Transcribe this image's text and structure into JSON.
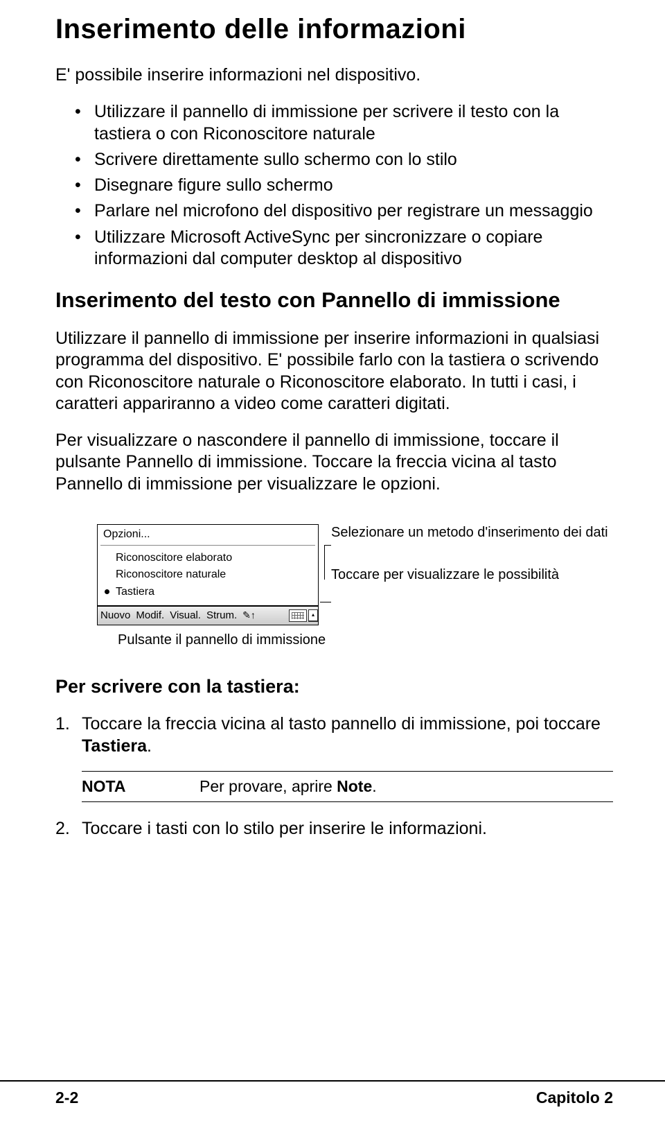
{
  "h1": "Inserimento delle informazioni",
  "intro": "E' possibile inserire informazioni nel dispositivo.",
  "bullets": [
    "Utilizzare il pannello di immissione per scrivere il testo con la tastiera o con Riconoscitore naturale",
    "Scrivere direttamente sullo schermo con lo stilo",
    "Disegnare figure sullo schermo",
    "Parlare nel microfono del dispositivo per registrare un messaggio",
    "Utilizzare Microsoft ActiveSync per sincronizzare o copiare informazioni dal computer desktop al dispositivo"
  ],
  "h2": "Inserimento del testo con Pannello di immissione",
  "para1": "Utilizzare il pannello di immissione per inserire informazioni in qualsiasi programma del dispositivo. E' possibile farlo con la tastiera o scrivendo con Riconoscitore naturale o Riconoscitore elaborato. In tutti i casi, i caratteri appariranno a video come caratteri digitati.",
  "para2": "Per visualizzare o nascondere il pannello di immissione, toccare il pulsante Pannello di immissione. Toccare la freccia vicina al tasto Pannello di immissione per visualizzare le opzioni.",
  "menu": {
    "opzioni": "Opzioni...",
    "items": [
      "Riconoscitore elaborato",
      "Riconoscitore naturale",
      "Tastiera"
    ]
  },
  "taskbar": {
    "nuovo": "Nuovo",
    "modif": "Modif.",
    "visual": "Visual.",
    "strum": "Strum.",
    "stylus": "✎↑"
  },
  "callout1": "Selezionare un metodo d'inserimento dei dati",
  "callout2": "Toccare per visualizzare le possibilità",
  "caption": "Pulsante il pannello di immissione",
  "h3": "Per scrivere con la tastiera:",
  "step1a": "Toccare la freccia vicina al tasto pannello di immissione, poi toccare ",
  "step1b": "Tastiera",
  "step1c": ".",
  "nota_label": "NOTA",
  "nota_text_a": "Per provare, aprire ",
  "nota_text_b": "Note",
  "nota_text_c": ".",
  "step2": "Toccare i tasti con lo stilo per inserire le informazioni.",
  "footer_left": "2-2",
  "footer_right": "Capitolo 2"
}
